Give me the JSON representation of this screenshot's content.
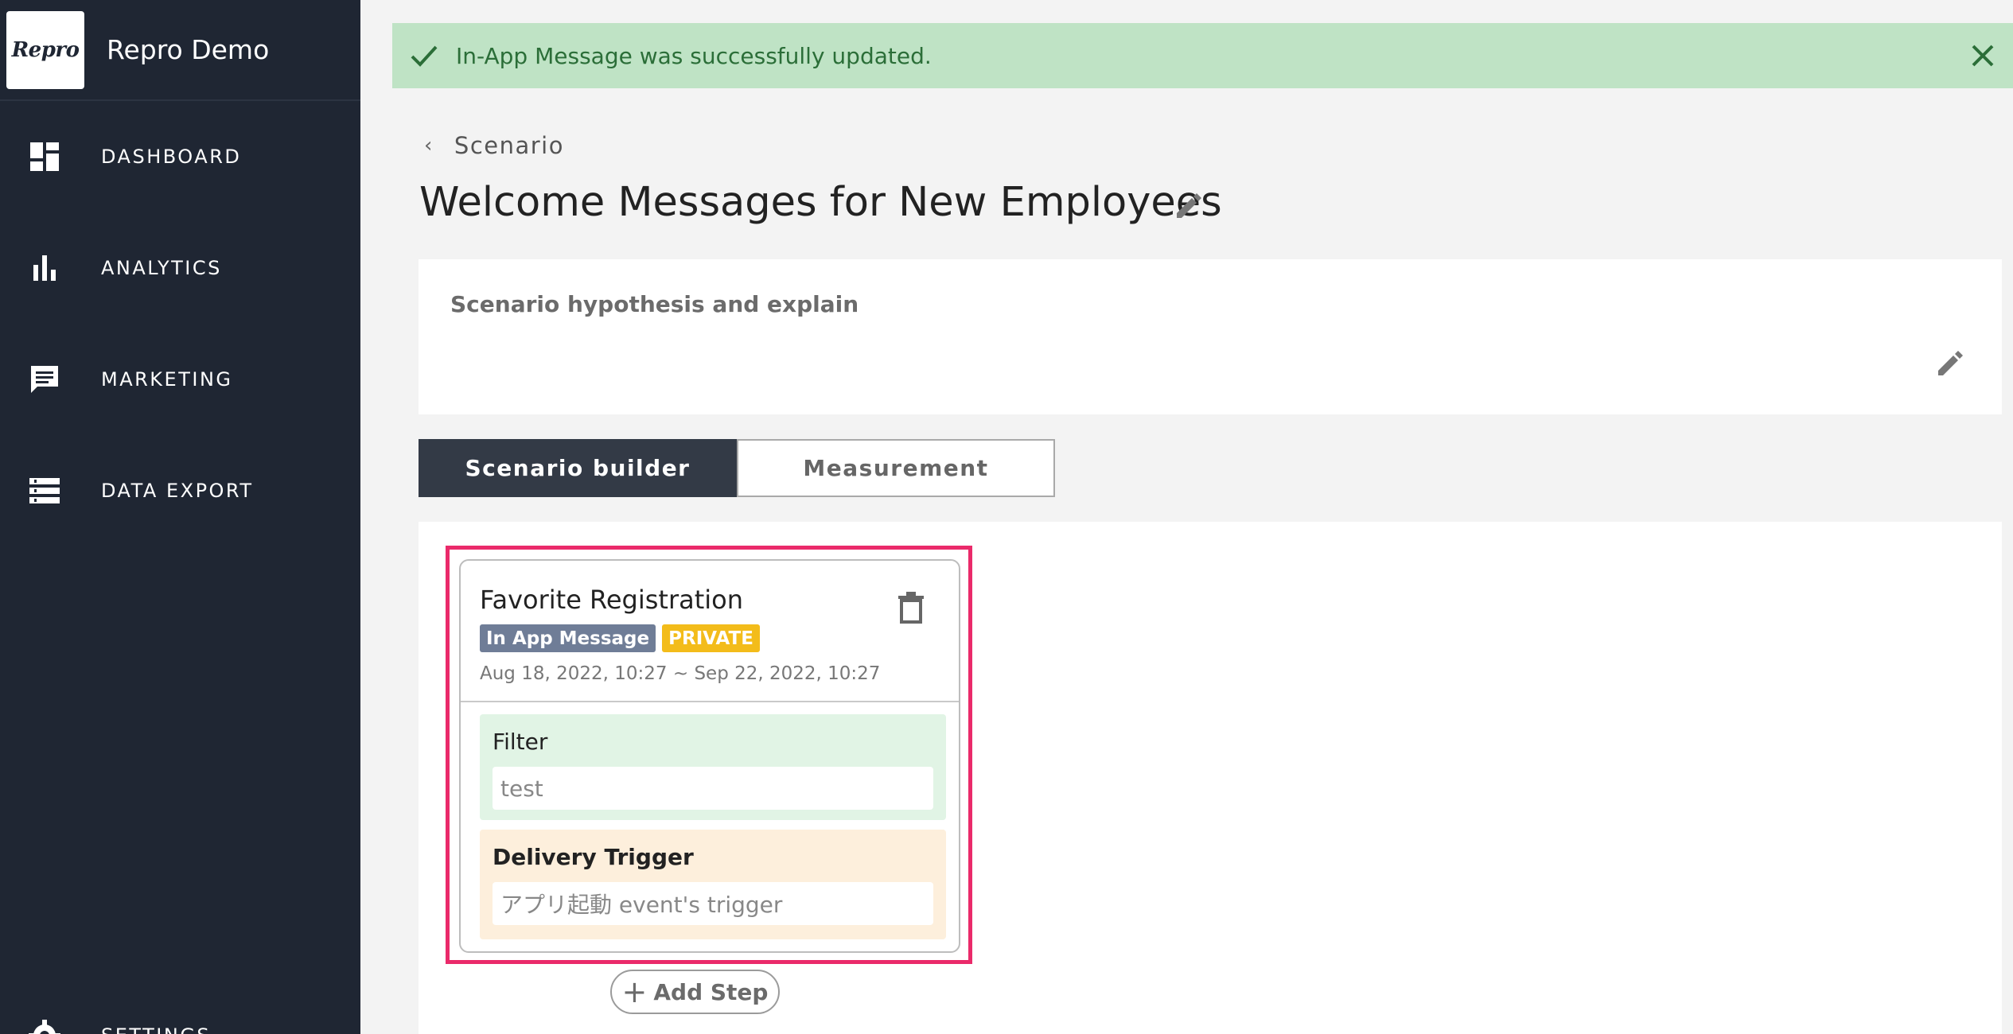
{
  "sidebar": {
    "logo_text": "Repro",
    "app_name": "Repro Demo",
    "items": [
      {
        "label": "DASHBOARD",
        "icon": "dashboard-icon"
      },
      {
        "label": "ANALYTICS",
        "icon": "bar-chart-icon"
      },
      {
        "label": "MARKETING",
        "icon": "chat-icon"
      },
      {
        "label": "DATA EXPORT",
        "icon": "list-icon"
      },
      {
        "label": "SETTINGS",
        "icon": "gear-icon"
      }
    ]
  },
  "alert": {
    "message": "In-App Message was successfully updated.",
    "icon": "check-icon",
    "close_icon": "close-icon"
  },
  "breadcrumb": {
    "label": "Scenario"
  },
  "page": {
    "title": "Welcome Messages for New Employees"
  },
  "hypothesis": {
    "label": "Scenario hypothesis and explain"
  },
  "tabs": [
    {
      "label": "Scenario builder",
      "active": true
    },
    {
      "label": "Measurement",
      "active": false
    }
  ],
  "step": {
    "title": "Favorite Registration",
    "type_badge": "In App Message",
    "status_badge": "PRIVATE",
    "dates": "Aug 18, 2022, 10:27 ~ Sep 22, 2022, 10:27",
    "filter": {
      "label": "Filter",
      "value": "test"
    },
    "trigger": {
      "label": "Delivery Trigger",
      "value": "アプリ起動 event's trigger"
    }
  },
  "add_step": {
    "label": "Add Step"
  },
  "colors": {
    "sidebar_bg": "#1f2633",
    "alert_bg": "#bfe3c5",
    "active_tab": "#333a46",
    "highlight": "#ea2a6a",
    "badge_type": "#6f7d97",
    "badge_private": "#f3bc1a",
    "filter_bg": "#e1f4e5",
    "trigger_bg": "#fdefdc"
  }
}
